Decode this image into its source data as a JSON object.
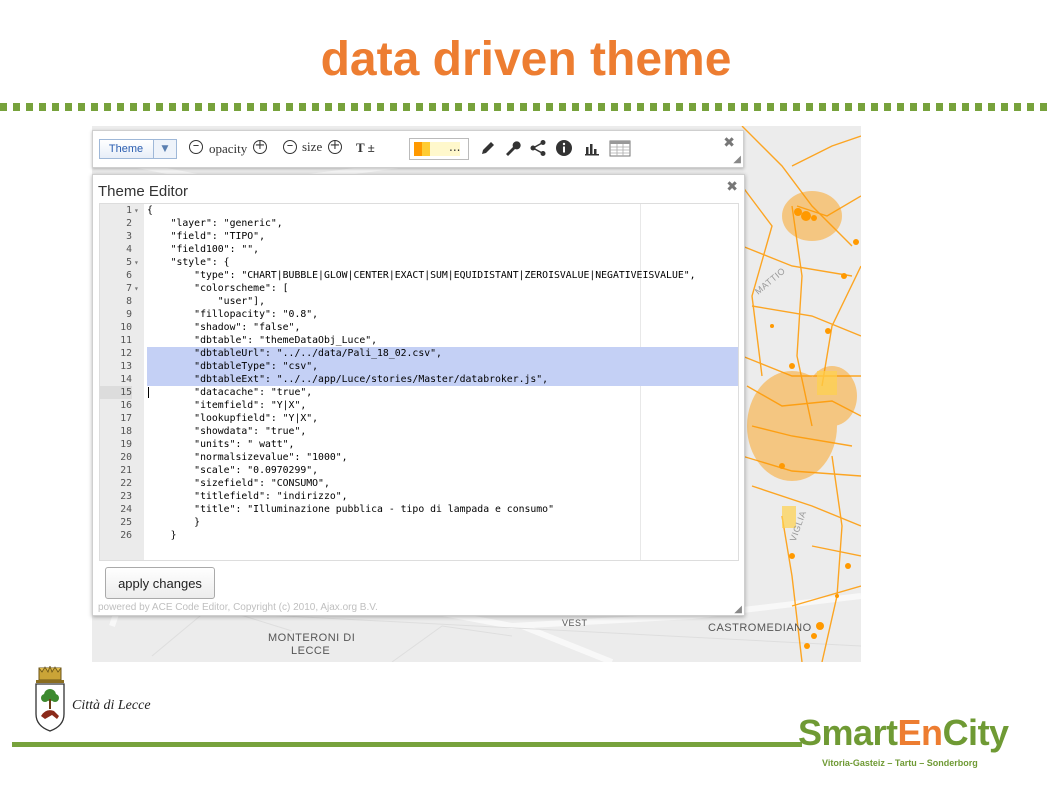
{
  "slide": {
    "title": "data driven theme"
  },
  "map": {
    "labels": {
      "monteroni_1": "MONTERONI DI",
      "monteroni_2": "LECCE",
      "castromediano": "CASTROMEDIANO",
      "vest": "VEST",
      "mattio": "MATTIO",
      "viglia": "VIGLIA"
    },
    "colors": {
      "background": "#ececec",
      "roads": "#ff9900",
      "highlight": "#ffd24d"
    }
  },
  "toolbar": {
    "theme_select": "Theme",
    "opacity_label": "opacity",
    "size_label": "size",
    "text_label": "T ±",
    "swatch_more": "...",
    "icons": [
      "minus-circle-icon",
      "plus-circle-icon",
      "pencil-icon",
      "wrench-icon",
      "share-icon",
      "info-icon",
      "bar-chart-icon",
      "table-icon",
      "close-icon"
    ]
  },
  "editor": {
    "title": "Theme Editor",
    "apply_label": "apply changes",
    "powered_by": "powered by ACE Code Editor, Copyright (c) 2010, Ajax.org B.V.",
    "lines": [
      {
        "n": "1",
        "fold": "▾",
        "text": "{"
      },
      {
        "n": "2",
        "text": "    \"layer\": \"generic\","
      },
      {
        "n": "3",
        "text": "    \"field\": \"TIPO\","
      },
      {
        "n": "4",
        "text": "    \"field100\": \"\","
      },
      {
        "n": "5",
        "fold": "▾",
        "text": "    \"style\": {"
      },
      {
        "n": "6",
        "text": "        \"type\": \"CHART|BUBBLE|GLOW|CENTER|EXACT|SUM|EQUIDISTANT|ZEROISVALUE|NEGATIVEISVALUE\","
      },
      {
        "n": "7",
        "fold": "▾",
        "text": "        \"colorscheme\": ["
      },
      {
        "n": "8",
        "text": "            \"user\"],"
      },
      {
        "n": "9",
        "text": "        \"fillopacity\": \"0.8\","
      },
      {
        "n": "10",
        "text": "        \"shadow\": \"false\","
      },
      {
        "n": "11",
        "text": "        \"dbtable\": \"themeDataObj_Luce\","
      },
      {
        "n": "12",
        "sel": true,
        "text": "        \"dbtableUrl\": \"../../data/Pali_18_02.csv\","
      },
      {
        "n": "13",
        "sel": true,
        "text": "        \"dbtableType\": \"csv\","
      },
      {
        "n": "14",
        "sel": true,
        "text": "        \"dbtableExt\": \"../../app/Luce/stories/Master/databroker.js\","
      },
      {
        "n": "15",
        "cur": true,
        "text": "        \"datacache\": \"true\","
      },
      {
        "n": "16",
        "text": "        \"itemfield\": \"Y|X\","
      },
      {
        "n": "17",
        "text": "        \"lookupfield\": \"Y|X\","
      },
      {
        "n": "18",
        "text": "        \"showdata\": \"true\","
      },
      {
        "n": "19",
        "text": "        \"units\": \" watt\","
      },
      {
        "n": "20",
        "text": "        \"normalsizevalue\": \"1000\","
      },
      {
        "n": "21",
        "text": "        \"scale\": \"0.0970299\","
      },
      {
        "n": "22",
        "text": "        \"sizefield\": \"CONSUMO\","
      },
      {
        "n": "23",
        "text": "        \"titlefield\": \"indirizzo\","
      },
      {
        "n": "24",
        "text": "        \"title\": \"Illuminazione pubblica - tipo di lampada e consumo\""
      },
      {
        "n": "25",
        "text": "        }"
      },
      {
        "n": "26",
        "text": "    }"
      }
    ]
  },
  "footer": {
    "city_name": "Città di Lecce",
    "brand_part1": "Smart",
    "brand_part2": "En",
    "brand_part3": "City",
    "brand_sub": "Vitoria-Gasteiz – Tartu – Sonderborg",
    "colors": {
      "green": "#77a23c",
      "orange": "#ed7d31"
    }
  }
}
